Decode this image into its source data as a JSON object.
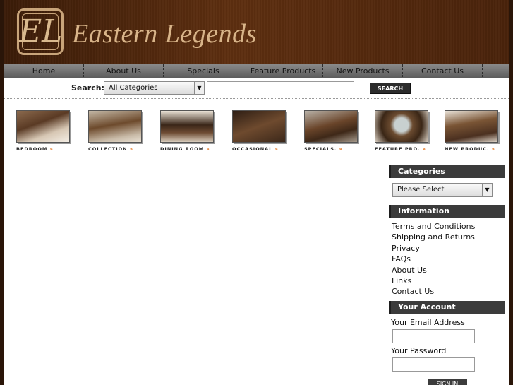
{
  "brand": {
    "monogram": "EL",
    "name": "Eastern Legends"
  },
  "nav": {
    "items": [
      {
        "label": "Home"
      },
      {
        "label": "About Us"
      },
      {
        "label": "Specials"
      },
      {
        "label": "Feature Products"
      },
      {
        "label": "New Products"
      },
      {
        "label": "Contact Us"
      }
    ]
  },
  "search": {
    "label": "Search:",
    "category_selected": "All Categories",
    "input_value": "",
    "button_label": "SEARCH"
  },
  "categories_strip": [
    {
      "label": "BEDROOM",
      "icon": "bedroom-photo"
    },
    {
      "label": "COLLECTION",
      "icon": "collection-photo"
    },
    {
      "label": "DINING ROOM",
      "icon": "dining-room-photo"
    },
    {
      "label": "OCCASIONAL",
      "icon": "occasional-photo"
    },
    {
      "label": "SPECIALS.",
      "icon": "specials-photo"
    },
    {
      "label": "FEATURE PRO.",
      "icon": "feature-products-photo"
    },
    {
      "label": "NEW PRODUC.",
      "icon": "new-products-photo"
    }
  ],
  "sidebar": {
    "categories": {
      "title": "Categories",
      "select_value": "Please Select"
    },
    "information": {
      "title": "Information",
      "links": [
        "Terms and Conditions",
        "Shipping and Returns",
        "Privacy",
        "FAQs",
        "About Us",
        "Links",
        "Contact Us"
      ]
    },
    "account": {
      "title": "Your Account",
      "email_label": "Your Email Address",
      "email_value": "",
      "password_label": "Your Password",
      "password_value": "",
      "signin_label": "SIGN IN"
    }
  },
  "colors": {
    "header_brown": "#4a230b",
    "brand_gold": "#d8b489",
    "nav_gray": "#707070",
    "arrow_orange": "#e06a10"
  }
}
